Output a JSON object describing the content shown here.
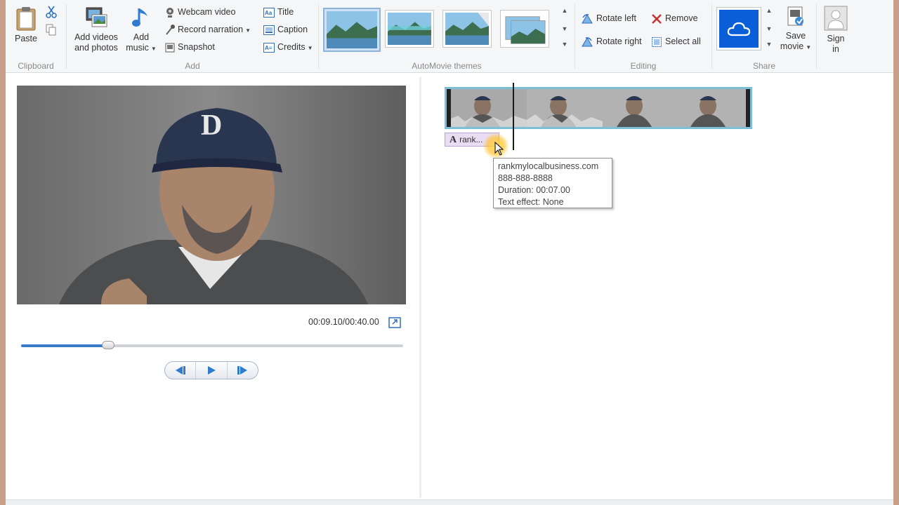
{
  "ribbon": {
    "clipboard": {
      "paste_label": "Paste",
      "group_label": "Clipboard"
    },
    "add": {
      "add_videos_label_1": "Add videos",
      "add_videos_label_2": "and photos",
      "add_music_label_1": "Add",
      "add_music_label_2": "music",
      "webcam_video": "Webcam video",
      "record_narration": "Record narration",
      "snapshot": "Snapshot",
      "title": "Title",
      "caption": "Caption",
      "credits": "Credits",
      "group_label": "Add"
    },
    "themes": {
      "group_label": "AutoMovie themes",
      "count": 4,
      "selected_index": 0
    },
    "editing": {
      "rotate_left": "Rotate left",
      "rotate_right": "Rotate right",
      "remove": "Remove",
      "select_all": "Select all",
      "group_label": "Editing"
    },
    "share": {
      "save_movie_1": "Save",
      "save_movie_2": "movie",
      "group_label": "Share"
    },
    "sign_in_1": "Sign",
    "sign_in_2": "in"
  },
  "preview": {
    "time_display": "00:09.10/00:40.00",
    "progress_fraction": 0.2275
  },
  "storyboard": {
    "caption_chip_label": "rank...",
    "tooltip": {
      "line1": "rankmylocalbusiness.com",
      "line2": "888-888-8888",
      "line3": "Duration: 00:07.00",
      "line4": "Text effect: None"
    }
  },
  "colors": {
    "accent": "#3b79c9",
    "clip_border": "#7cc0d8",
    "caption_bg": "#e9ddf4",
    "onedrive_blue": "#0a5fd8"
  }
}
